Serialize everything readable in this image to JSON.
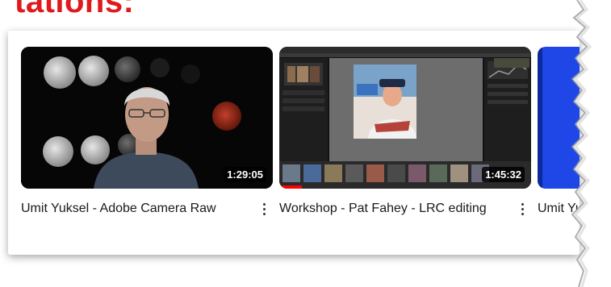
{
  "heading": {
    "text": "tations:"
  },
  "videos": [
    {
      "title": "Umit Yuksel - Adobe Camera Raw",
      "duration": "1:29:05",
      "progress": 0
    },
    {
      "title": "Workshop - Pat Fahey - LRC editing",
      "duration": "1:45:32",
      "progress": 0.09
    },
    {
      "title": "Umit Yuksel Mana",
      "duration": "",
      "progress": 0
    }
  ],
  "colors": {
    "accent": "#e0191c",
    "progress": "#ff0000",
    "thumb3": "#1f47e8"
  }
}
